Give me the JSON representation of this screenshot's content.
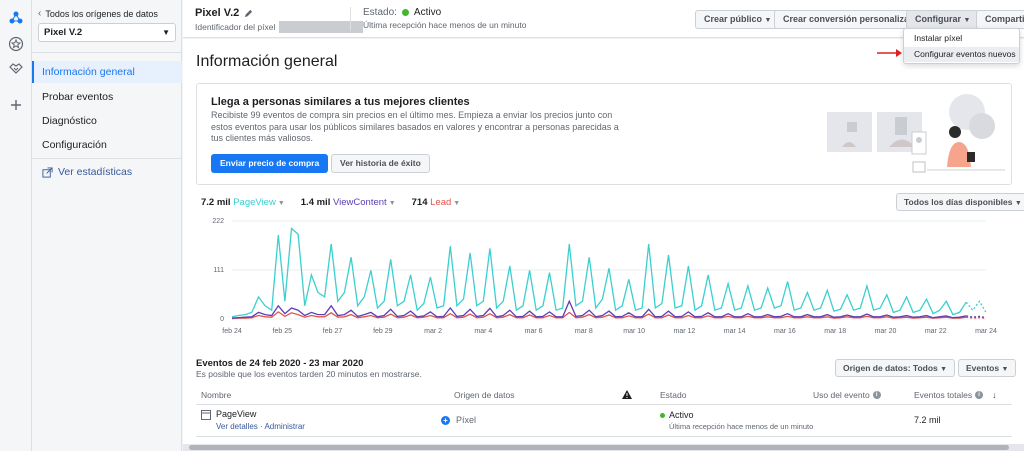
{
  "sidebar": {
    "back_label": "Todos los orígenes de datos",
    "pixel_select": "Pixel V.2",
    "nav": [
      {
        "label": "Información general",
        "active": true
      },
      {
        "label": "Probar eventos",
        "active": false
      },
      {
        "label": "Diagnóstico",
        "active": false
      },
      {
        "label": "Configuración",
        "active": false
      }
    ],
    "stats_link": "Ver estadísticas"
  },
  "rail_icons": [
    "events-manager-icon",
    "star-badge-icon",
    "handshake-icon",
    "plus-icon"
  ],
  "header": {
    "pixel_name": "Pixel V.2",
    "pixel_id_label": "Identificador del píxel",
    "status_label": "Estado:",
    "status_value": "Activo",
    "status_color": "#42b72a",
    "last_received": "Última recepción hace menos de un minuto",
    "buttons": {
      "create_audience": "Crear público",
      "create_conversion": "Crear conversión personalizada",
      "configure": "Configurar",
      "share": "Compartir"
    }
  },
  "configure_menu": {
    "items": [
      "Instalar píxel",
      "Configurar eventos nuevos"
    ],
    "highlighted_index": 1
  },
  "main": {
    "title": "Información general",
    "banner": {
      "heading": "Llega a personas similares a tus mejores clientes",
      "body": "Recibiste 99 eventos de compra sin precios en el último mes. Empieza a enviar los precios junto con estos eventos para usar los públicos similares basados en valores y encontrar a personas parecidas a tus clientes más valiosos.",
      "primary_button": "Enviar precio de compra",
      "secondary_button": "Ver historia de éxito"
    },
    "metrics": [
      {
        "value": "7.2 mil",
        "name": "PageView",
        "color": "#3ccfcf"
      },
      {
        "value": "1.4 mil",
        "name": "ViewContent",
        "color": "#5b3fb5"
      },
      {
        "value": "714",
        "name": "Lead",
        "color": "#e0554a"
      }
    ],
    "range_button": "Todos los días disponibles",
    "events_title": "Eventos de 24 feb 2020 - 23 mar 2020",
    "events_subtitle": "Es posible que los eventos tarden 20 minutos en mostrarse.",
    "source_button": "Origen de datos: Todos",
    "events_button": "Eventos",
    "table": {
      "headers": [
        "Nombre",
        "Origen de datos",
        "Estado",
        "Uso del evento",
        "Eventos totales"
      ],
      "rows": [
        {
          "name": "PageView",
          "links": "Ver detalles · Administrar",
          "source": "Píxel",
          "status": "Activo",
          "status_detail": "Última recepción hace menos de un minuto",
          "total": "7.2 mil"
        }
      ]
    }
  },
  "chart_data": {
    "type": "line",
    "yticks": [
      0,
      111,
      222
    ],
    "ylim": [
      0,
      222
    ],
    "x_tick_labels": [
      "feb 24",
      "feb 25",
      "feb 27",
      "feb 29",
      "mar 2",
      "mar 4",
      "mar 6",
      "mar 8",
      "mar 10",
      "mar 12",
      "mar 14",
      "mar 16",
      "mar 18",
      "mar 20",
      "mar 22",
      "mar 24"
    ],
    "legend_placement": "top-left",
    "grid": true,
    "series": [
      {
        "name": "PageView",
        "color": "#3ccfcf",
        "values": [
          5,
          8,
          10,
          15,
          50,
          30,
          20,
          190,
          40,
          205,
          192,
          30,
          100,
          60,
          50,
          170,
          40,
          60,
          140,
          30,
          50,
          110,
          25,
          40,
          135,
          30,
          40,
          100,
          20,
          35,
          95,
          25,
          30,
          165,
          30,
          45,
          150,
          30,
          40,
          160,
          25,
          40,
          120,
          20,
          30,
          110,
          20,
          30,
          105,
          20,
          25,
          170,
          30,
          40,
          140,
          25,
          45,
          115,
          20,
          30,
          90,
          20,
          25,
          170,
          25,
          35,
          145,
          25,
          30,
          120,
          20,
          30,
          100,
          20,
          25,
          80,
          20,
          25,
          75,
          20,
          25,
          70,
          25,
          30,
          85,
          20,
          25,
          60,
          20,
          25,
          65,
          18,
          22,
          55,
          20,
          25,
          75,
          20,
          25,
          55,
          15,
          20,
          50,
          15,
          20,
          45,
          12,
          20,
          40,
          10,
          15,
          38,
          20,
          40,
          15
        ]
      },
      {
        "name": "ViewContent",
        "color": "#5b3fb5",
        "values": [
          2,
          3,
          4,
          5,
          15,
          10,
          8,
          30,
          12,
          25,
          20,
          8,
          15,
          10,
          10,
          30,
          8,
          10,
          20,
          6,
          10,
          15,
          5,
          8,
          22,
          6,
          8,
          18,
          5,
          7,
          16,
          5,
          6,
          25,
          6,
          8,
          22,
          6,
          8,
          24,
          5,
          8,
          20,
          5,
          6,
          18,
          5,
          6,
          16,
          5,
          5,
          40,
          6,
          8,
          20,
          5,
          8,
          18,
          5,
          6,
          14,
          5,
          5,
          22,
          5,
          6,
          18,
          5,
          6,
          16,
          5,
          6,
          14,
          5,
          5,
          12,
          5,
          5,
          12,
          5,
          5,
          10,
          5,
          6,
          12,
          5,
          5,
          10,
          5,
          5,
          10,
          4,
          5,
          9,
          5,
          5,
          11,
          5,
          5,
          9,
          4,
          5,
          8,
          4,
          5,
          8,
          3,
          5,
          7,
          3,
          4,
          7,
          4,
          6,
          3
        ]
      },
      {
        "name": "Lead",
        "color": "#e0554a",
        "values": [
          1,
          2,
          2,
          3,
          8,
          5,
          4,
          16,
          6,
          14,
          10,
          4,
          8,
          5,
          5,
          14,
          4,
          5,
          10,
          3,
          5,
          8,
          3,
          4,
          11,
          3,
          4,
          9,
          3,
          4,
          8,
          3,
          3,
          12,
          3,
          4,
          11,
          3,
          4,
          12,
          3,
          4,
          10,
          3,
          3,
          9,
          3,
          3,
          8,
          3,
          3,
          15,
          3,
          4,
          10,
          3,
          4,
          9,
          3,
          3,
          7,
          3,
          3,
          11,
          3,
          3,
          9,
          3,
          3,
          8,
          3,
          3,
          7,
          3,
          3,
          6,
          3,
          3,
          6,
          3,
          3,
          5,
          3,
          3,
          6,
          3,
          3,
          5,
          3,
          3,
          5,
          2,
          3,
          5,
          3,
          3,
          6,
          3,
          3,
          5,
          2,
          3,
          4,
          2,
          3,
          4,
          2,
          3,
          4,
          2,
          2,
          4,
          2,
          3,
          2
        ]
      }
    ]
  }
}
